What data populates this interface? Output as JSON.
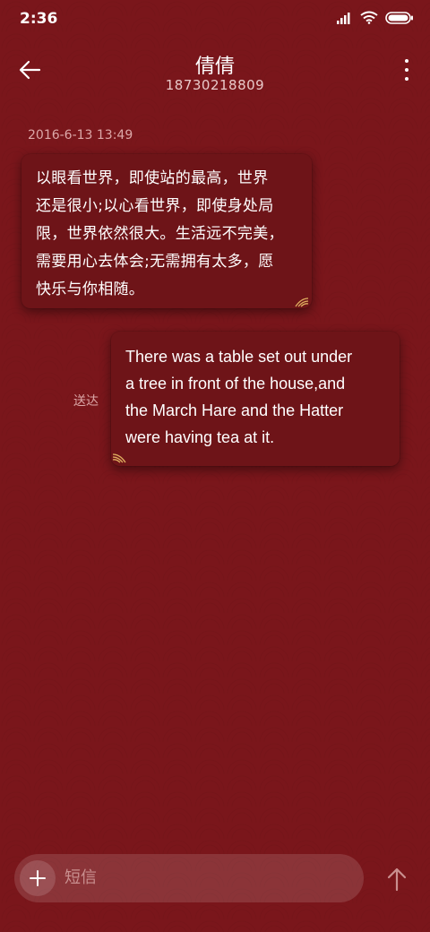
{
  "status_bar": {
    "time": "2:36",
    "icons": [
      "signal-icon",
      "wifi-icon",
      "battery-icon"
    ]
  },
  "header": {
    "title": "倩倩",
    "subtitle": "18730218809",
    "back_icon": "back-arrow-icon",
    "menu_icon": "more-vert-icon"
  },
  "conversation": {
    "timestamp": "2016-6-13 13:49",
    "messages": [
      {
        "direction": "incoming",
        "lines": [
          "以眼看世界，即使站的最高，世界",
          "还是很小;以心看世界，即使身处局",
          "限，世界依然很大。生活远不完美，",
          "需要用心去体会;无需拥有太多，愿",
          "快乐与你相随。"
        ]
      },
      {
        "direction": "outgoing",
        "status": "送达",
        "lines": [
          "There was a table set out under",
          "a tree in front of the house,and",
          "the March Hare and the Hatter",
          "were having tea at it."
        ]
      }
    ]
  },
  "composer": {
    "placeholder": "短信",
    "add_icon": "plus-icon",
    "send_icon": "send-arrow-icon"
  },
  "colors": {
    "background": "#7a161b",
    "bubble": "#6e1418",
    "accent_gold": "#e0b060",
    "muted_text": "#dca8a8"
  }
}
